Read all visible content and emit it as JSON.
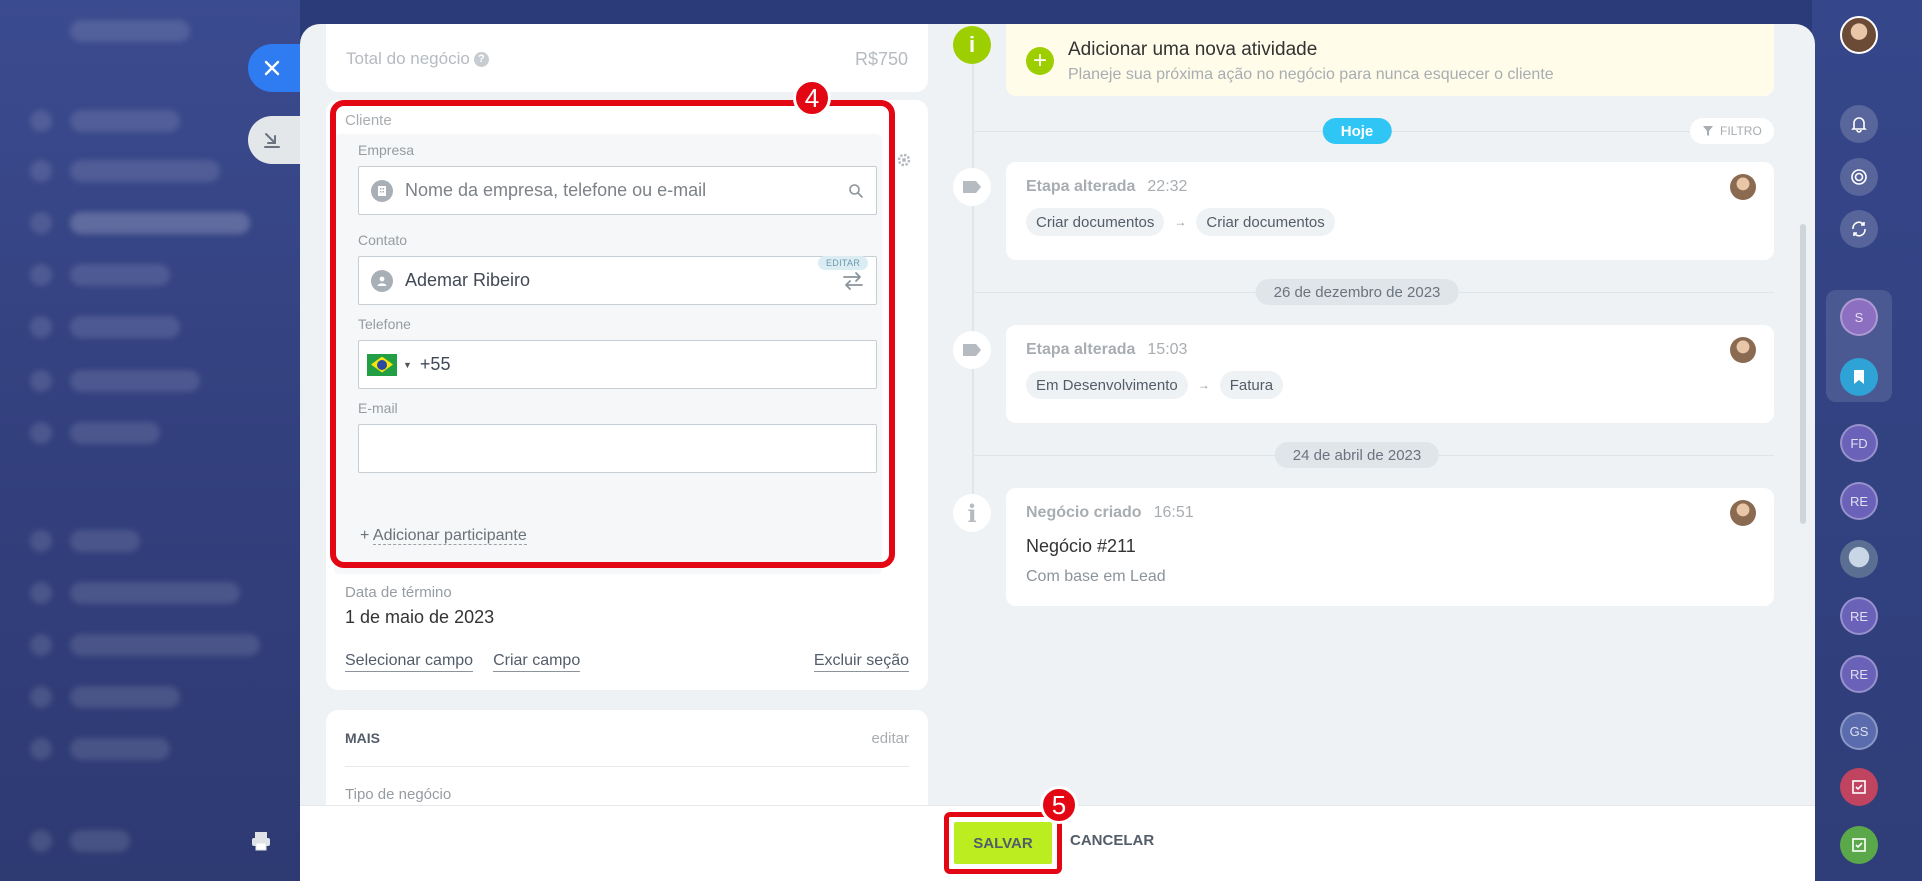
{
  "deal": {
    "total_label": "Total do negócio",
    "total_value": "R$750"
  },
  "client": {
    "section_title": "Cliente",
    "company_label": "Empresa",
    "company_placeholder": "Nome da empresa, telefone ou e-mail",
    "contact_label": "Contato",
    "contact_edit_badge": "EDITAR",
    "contact_value": "Ademar Ribeiro",
    "phone_label": "Telefone",
    "phone_code": "+55",
    "email_label": "E-mail",
    "email_value": "",
    "add_participant": "Adicionar participante"
  },
  "end_date": {
    "label": "Data de término",
    "value": "1 de maio de 2023"
  },
  "section_links": {
    "select_field": "Selecionar campo",
    "create_field": "Criar campo",
    "delete_section": "Excluir seção"
  },
  "more": {
    "title": "MAIS",
    "edit": "editar",
    "deal_type_label": "Tipo de negócio"
  },
  "timeline": {
    "new_activity_title": "Adicionar uma nova atividade",
    "new_activity_subtitle": "Planeje sua próxima ação no negócio para nunca esquecer o cliente",
    "today_label": "Hoje",
    "filter_label": "FILTRO",
    "items": [
      {
        "title": "Etapa alterada",
        "time": "22:32",
        "from": "Criar documentos",
        "to": "Criar documentos"
      },
      {
        "date_separator": "26 de dezembro de 2023",
        "title": "Etapa alterada",
        "time": "15:03",
        "from": "Em Desenvolvimento",
        "to": "Fatura"
      },
      {
        "date_separator": "24 de abril de 2023",
        "title": "Negócio criado",
        "time": "16:51",
        "body": "Negócio #211",
        "note": "Com base em Lead"
      }
    ]
  },
  "footer": {
    "save": "SALVAR",
    "cancel": "CANCELAR"
  },
  "annotations": {
    "step_4": "4",
    "step_5": "5"
  },
  "rail": {
    "avatars": [
      "S",
      "FD",
      "RE",
      "RE",
      "RE",
      "GS"
    ]
  },
  "colors": {
    "accent_blue": "#2f7bf1",
    "save_green": "#bbed21",
    "activity_green": "#9dcf00",
    "today_pill": "#2fc6f6",
    "annotation_red": "#e30613"
  }
}
